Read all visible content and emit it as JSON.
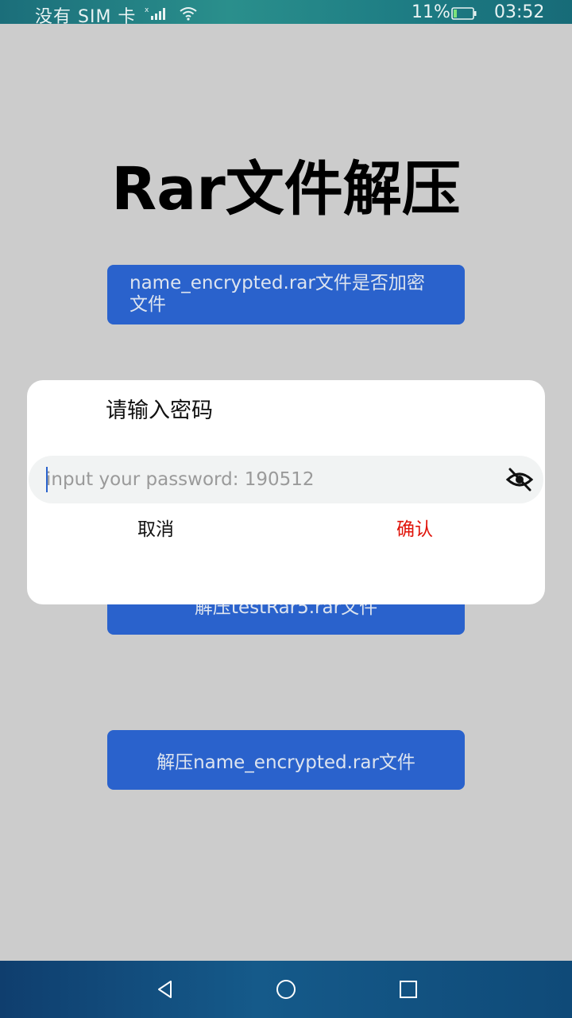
{
  "status_bar": {
    "carrier": "没有 SIM 卡",
    "battery_percent": "11%",
    "time": "03:52"
  },
  "page": {
    "title": "Rar文件解压",
    "check_encrypted_button": "name_encrypted.rar文件是否加密文件",
    "extract_rar5_button": "解压testRar5.rar文件",
    "extract_encrypted_button": "解压name_encrypted.rar文件"
  },
  "dialog": {
    "title": "请输入密码",
    "password_placeholder": "input your password: 190512",
    "password_value": "",
    "cancel_label": "取消",
    "confirm_label": "确认",
    "confirm_color": "#e0140a"
  },
  "colors": {
    "accent": "#2a62cc",
    "background": "#cccccc"
  }
}
